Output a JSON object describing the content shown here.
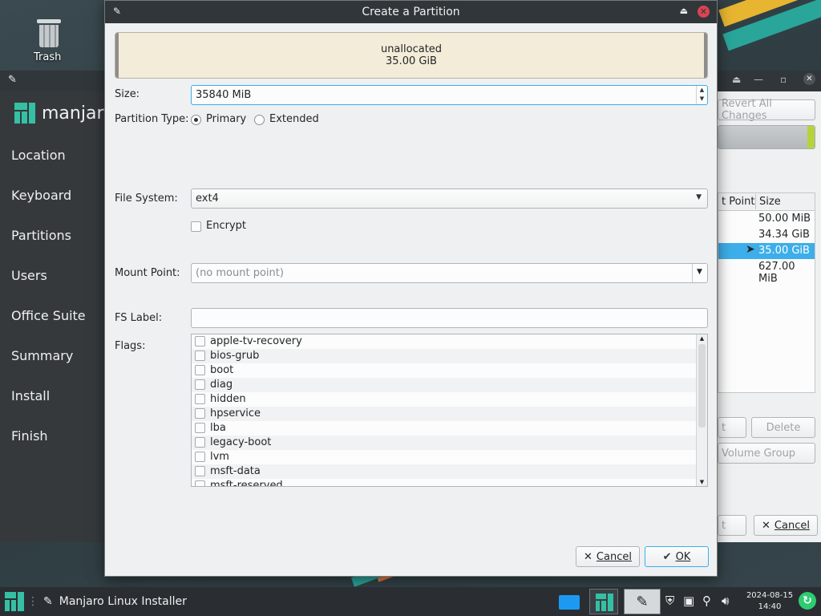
{
  "desktop": {
    "trash_label": "Trash"
  },
  "installer": {
    "brand": "manjaro",
    "steps": [
      "Location",
      "Keyboard",
      "Partitions",
      "Users",
      "Office Suite",
      "Summary",
      "Install",
      "Finish"
    ],
    "revert_label": "Revert All Changes",
    "table": {
      "col_mount": "t Point",
      "col_size": "Size",
      "rows": [
        "50.00 MiB",
        "34.34 GiB",
        "35.00 GiB",
        "627.00 MiB"
      ],
      "selected_index": 2
    },
    "edit_label_partial": "t",
    "delete_label": "Delete",
    "volume_group_label": "Volume Group",
    "next_label_partial": "t",
    "cancel_label": "Cancel"
  },
  "dialog": {
    "title": "Create a Partition",
    "unallocated": {
      "label": "unallocated",
      "size": "35.00 GiB"
    },
    "size": {
      "label": "Size:",
      "value": "35840 MiB"
    },
    "partition_type": {
      "label": "Partition Type:",
      "options": [
        "Primary",
        "Extended"
      ],
      "selected": "Primary"
    },
    "file_system": {
      "label": "File System:",
      "value": "ext4"
    },
    "encrypt_label": "Encrypt",
    "mount_point": {
      "label": "Mount Point:",
      "placeholder": "(no mount point)"
    },
    "fs_label": {
      "label": "FS Label:",
      "value": ""
    },
    "flags": {
      "label": "Flags:",
      "items": [
        "apple-tv-recovery",
        "bios-grub",
        "boot",
        "diag",
        "hidden",
        "hpservice",
        "lba",
        "legacy-boot",
        "lvm",
        "msft-data",
        "msft-reserved"
      ]
    },
    "cancel_label": "Cancel",
    "ok_label": "OK"
  },
  "taskbar": {
    "task_title": "Manjaro Linux Installer",
    "date": "2024-08-15",
    "time": "14:40",
    "accent": "#35bfa4"
  }
}
